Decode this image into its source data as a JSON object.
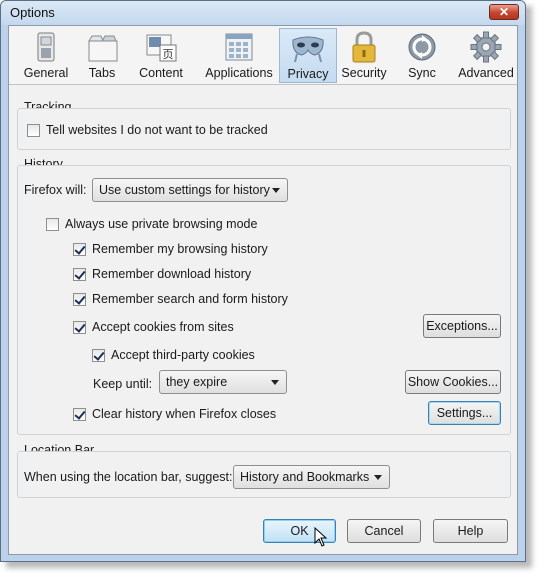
{
  "window": {
    "title": "Options",
    "close_glyph": "✕"
  },
  "toolbar": {
    "tabs": [
      {
        "label": "General",
        "icon": "general-icon"
      },
      {
        "label": "Tabs",
        "icon": "tabs-icon"
      },
      {
        "label": "Content",
        "icon": "content-icon"
      },
      {
        "label": "Applications",
        "icon": "applications-icon"
      },
      {
        "label": "Privacy",
        "icon": "privacy-mask-icon",
        "selected": true
      },
      {
        "label": "Security",
        "icon": "padlock-icon"
      },
      {
        "label": "Sync",
        "icon": "sync-icon"
      },
      {
        "label": "Advanced",
        "icon": "gear-icon"
      }
    ]
  },
  "tracking": {
    "title": "Tracking",
    "dnt_label": "Tell websites I do not want to be tracked",
    "dnt_checked": false
  },
  "history": {
    "title": "History",
    "will_label": "Firefox will:",
    "will_value": "Use custom settings for history",
    "private_label": "Always use private browsing mode",
    "private_checked": false,
    "browsing_label": "Remember my browsing history",
    "download_label": "Remember download history",
    "search_label": "Remember search and form history",
    "cookies_label": "Accept cookies from sites",
    "exceptions_button": "Exceptions...",
    "third_party_label": "Accept third-party cookies",
    "keep_until_label": "Keep until:",
    "keep_until_value": "they expire",
    "show_cookies_button": "Show Cookies...",
    "clear_label": "Clear history when Firefox closes",
    "settings_button": "Settings..."
  },
  "location_bar": {
    "title": "Location Bar",
    "suggest_label": "When using the location bar, suggest:",
    "suggest_value": "History and Bookmarks"
  },
  "footer": {
    "ok": "OK",
    "cancel": "Cancel",
    "help": "Help"
  },
  "colors": {
    "selected_tab": "#c5dbf1",
    "window_frame": "#bcd2ea",
    "close_button": "#c6452f"
  }
}
